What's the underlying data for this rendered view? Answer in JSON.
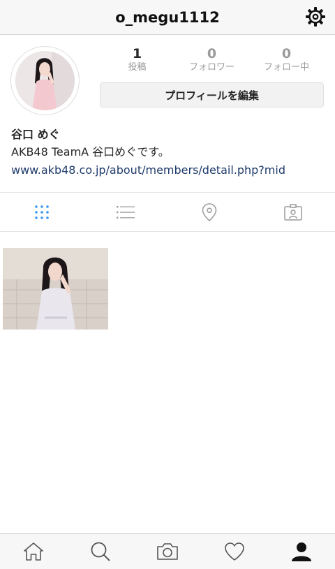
{
  "header": {
    "username": "o_megu1112",
    "settings_icon": "gear-icon"
  },
  "profile": {
    "stats": [
      {
        "count": "1",
        "label": "投稿"
      },
      {
        "count": "0",
        "label": "フォロワー"
      },
      {
        "count": "0",
        "label": "フォロー中"
      }
    ],
    "edit_button_label": "プロフィールを編集"
  },
  "bio": {
    "name": "谷口 めぐ",
    "text": "AKB48 TeamA 谷口めぐです。",
    "link": "www.akb48.co.jp/about/members/detail.php?mid"
  },
  "tabs": [
    {
      "icon": "grid-icon",
      "active": true
    },
    {
      "icon": "list-icon",
      "active": false
    },
    {
      "icon": "location-pin-icon",
      "active": false
    },
    {
      "icon": "tagged-person-icon",
      "active": false
    }
  ],
  "posts_count_shown": 1,
  "bottom_nav": [
    {
      "icon": "home-icon"
    },
    {
      "icon": "search-icon"
    },
    {
      "icon": "camera-icon"
    },
    {
      "icon": "heart-icon"
    },
    {
      "icon": "profile-icon",
      "active": true
    }
  ],
  "colors": {
    "accent_blue": "#3897f0",
    "link": "#1f3b6b",
    "muted": "#9a9a9a"
  }
}
